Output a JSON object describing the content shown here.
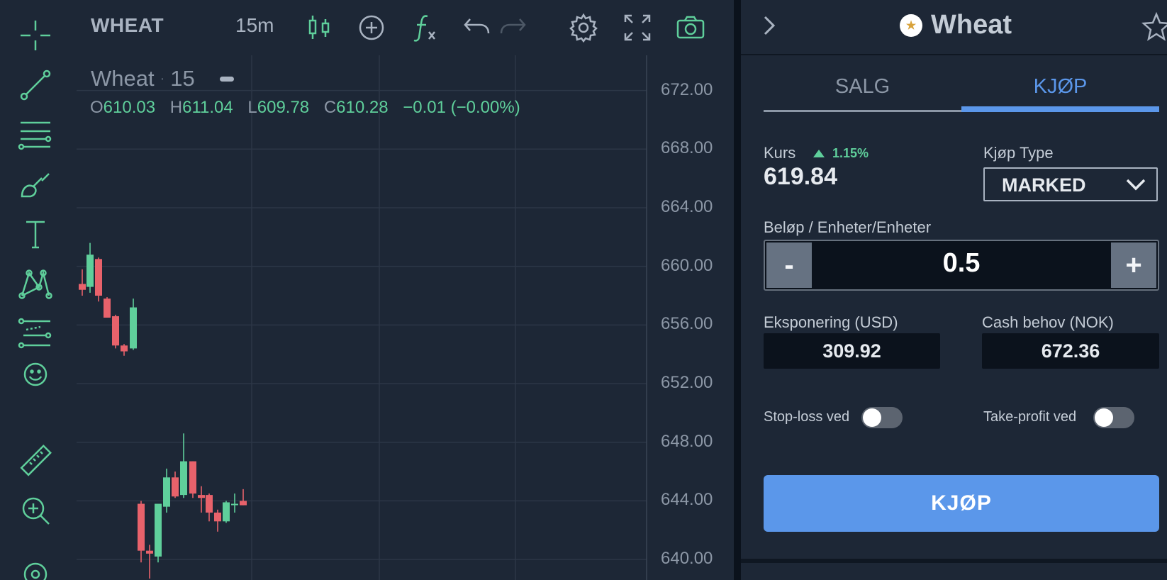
{
  "toolbar": {
    "symbol": "WHEAT",
    "interval": "15m",
    "icons": [
      "crosshair-icon",
      "trendline-icon",
      "horizontal-lines-icon",
      "brush-icon",
      "text-icon",
      "pattern-icon",
      "prediction-icon",
      "emoji-icon",
      "ruler-icon",
      "zoom-in-icon",
      "magnet-icon",
      "candles-icon",
      "add-indicator-icon",
      "function-icon",
      "undo-icon",
      "redo-icon",
      "settings-icon",
      "fullscreen-icon",
      "camera-icon"
    ]
  },
  "legend": {
    "name": "Wheat",
    "interval": "15",
    "open_key": "O",
    "open": "610.03",
    "high_key": "H",
    "high": "611.04",
    "low_key": "L",
    "low": "609.78",
    "close_key": "C",
    "close": "610.28",
    "change": "−0.01 (−0.00%)"
  },
  "price_axis": [
    "672.00",
    "668.00",
    "664.00",
    "660.00",
    "656.00",
    "652.00",
    "648.00",
    "644.00",
    "640.00"
  ],
  "colors": {
    "up": "#5fcf9b",
    "down": "#e8626b",
    "accent": "#5b97ea",
    "background": "#1d2736"
  },
  "chart_data": {
    "type": "candlestick",
    "ylim": [
      638.6,
      674.4
    ],
    "candles": [
      {
        "o": 658.8,
        "h": 659.8,
        "l": 658.0,
        "c": 658.4
      },
      {
        "o": 658.6,
        "h": 661.6,
        "l": 658.2,
        "c": 660.8
      },
      {
        "o": 660.5,
        "h": 660.6,
        "l": 657.6,
        "c": 658.0
      },
      {
        "o": 657.8,
        "h": 657.9,
        "l": 656.6,
        "c": 656.5
      },
      {
        "o": 656.6,
        "h": 656.7,
        "l": 654.4,
        "c": 654.6
      },
      {
        "o": 654.6,
        "h": 654.7,
        "l": 653.9,
        "c": 654.2
      },
      {
        "o": 654.4,
        "h": 657.8,
        "l": 654.3,
        "c": 657.2
      },
      {
        "o": 643.8,
        "h": 644.0,
        "l": 639.8,
        "c": 640.6
      },
      {
        "o": 640.6,
        "h": 641.0,
        "l": 638.7,
        "c": 640.4
      },
      {
        "o": 640.2,
        "h": 642.8,
        "l": 639.8,
        "c": 643.8
      },
      {
        "o": 643.6,
        "h": 646.2,
        "l": 643.2,
        "c": 645.6
      },
      {
        "o": 645.6,
        "h": 646.0,
        "l": 644.2,
        "c": 644.3
      },
      {
        "o": 644.4,
        "h": 648.6,
        "l": 644.2,
        "c": 646.7
      },
      {
        "o": 646.7,
        "h": 646.7,
        "l": 644.2,
        "c": 644.5
      },
      {
        "o": 644.4,
        "h": 645.0,
        "l": 643.2,
        "c": 644.2
      },
      {
        "o": 644.4,
        "h": 644.5,
        "l": 642.6,
        "c": 643.2
      },
      {
        "o": 643.2,
        "h": 643.4,
        "l": 641.9,
        "c": 642.6
      },
      {
        "o": 642.6,
        "h": 644.0,
        "l": 642.5,
        "c": 643.9
      },
      {
        "o": 643.8,
        "h": 644.5,
        "l": 643.2,
        "c": 643.8
      },
      {
        "o": 644.0,
        "h": 644.8,
        "l": 643.7,
        "c": 643.7
      }
    ]
  },
  "panel": {
    "asset_logo": "★",
    "asset_name": "Wheat",
    "tabs": {
      "sell": "SALG",
      "buy": "KJØP"
    },
    "kurs_label": "Kurs",
    "kurs_change": "1.15%",
    "kurs_value": "619.84",
    "buy_type_label": "Kjøp Type",
    "buy_type_value": "MARKED",
    "amount_label": "Beløp / Enheter/Enheter",
    "amount_minus": "-",
    "amount_plus": "+",
    "amount_value": "0.5",
    "exposure_label": "Eksponering (USD)",
    "exposure_value": "309.92",
    "cash_label": "Cash behov (NOK)",
    "cash_value": "672.36",
    "stop_loss_label": "Stop-loss ved",
    "take_profit_label": "Take-profit ved",
    "stop_loss_on": false,
    "take_profit_on": false,
    "buy_button": "KJØP"
  }
}
